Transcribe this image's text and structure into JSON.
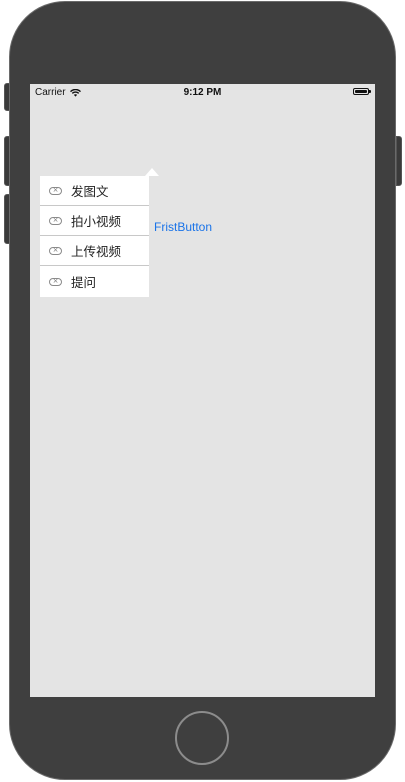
{
  "status_bar": {
    "carrier": "Carrier",
    "time": "9:12 PM",
    "wifi_icon": "wifi-icon",
    "battery_icon": "battery-icon",
    "battery_level": 1.0
  },
  "popover": {
    "items": [
      {
        "label": "发图文",
        "icon": "close-circle-icon"
      },
      {
        "label": "拍小视频",
        "icon": "close-circle-icon"
      },
      {
        "label": "上传视频",
        "icon": "close-circle-icon"
      },
      {
        "label": "提问",
        "icon": "close-circle-icon"
      }
    ]
  },
  "main": {
    "first_button_label": "FristButton"
  },
  "colors": {
    "device_body": "#3f3f3f",
    "screen_background": "#e4e4e4",
    "button_text": "#1a73e8",
    "menu_background": "#ffffff"
  }
}
